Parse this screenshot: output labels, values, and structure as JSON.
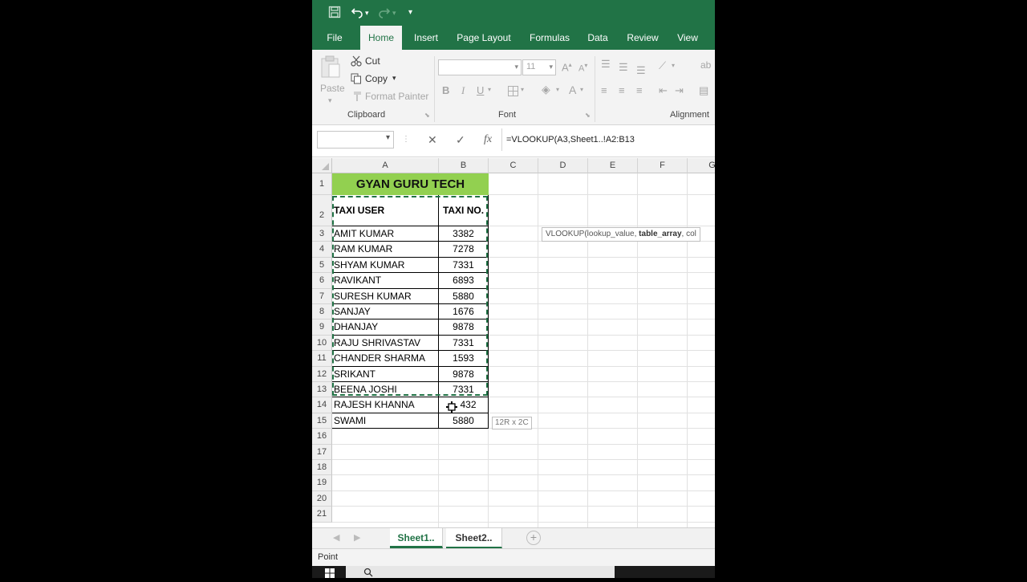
{
  "titlebar": {
    "save_icon": "save-icon",
    "undo_icon": "undo-icon",
    "redo_icon": "redo-icon",
    "customize_icon": "customize-quick-access-icon"
  },
  "ribbon_tabs": [
    "File",
    "Home",
    "Insert",
    "Page Layout",
    "Formulas",
    "Data",
    "Review",
    "View"
  ],
  "active_tab": "Home",
  "clipboard": {
    "paste_label": "Paste",
    "cut_label": "Cut",
    "copy_label": "Copy",
    "format_painter_label": "Format Painter",
    "group_label": "Clipboard"
  },
  "font_group": {
    "font_name": "",
    "font_size": "11",
    "bold": "B",
    "italic": "I",
    "underline": "U",
    "group_label": "Font"
  },
  "alignment_group": {
    "group_label": "Alignment"
  },
  "formula_bar": {
    "name_box": "",
    "cancel_symbol": "✕",
    "enter_symbol": "✓",
    "fx_symbol": "fx",
    "formula": "=VLOOKUP(A3,Sheet1..!A2:B13"
  },
  "columns": [
    "A",
    "B",
    "C",
    "D",
    "E",
    "F",
    "G"
  ],
  "rows": [
    "1",
    "2",
    "3",
    "4",
    "5",
    "6",
    "7",
    "8",
    "9",
    "10",
    "11",
    "12",
    "13",
    "14",
    "15",
    "16",
    "17",
    "18",
    "19",
    "20",
    "21"
  ],
  "sheet": {
    "title": "GYAN GURU TECH",
    "header_a": "TAXI USER",
    "header_b": "TAXI NO.",
    "data": [
      {
        "user": "AMIT KUMAR",
        "no": "3382"
      },
      {
        "user": "RAM KUMAR",
        "no": "7278"
      },
      {
        "user": "SHYAM KUMAR",
        "no": "7331"
      },
      {
        "user": "RAVIKANT",
        "no": "6893"
      },
      {
        "user": "SURESH KUMAR",
        "no": "5880"
      },
      {
        "user": "SANJAY",
        "no": "1676"
      },
      {
        "user": "DHANJAY",
        "no": "9878"
      },
      {
        "user": "RAJU SHRIVASTAV",
        "no": "7331"
      },
      {
        "user": "CHANDER SHARMA",
        "no": "1593"
      },
      {
        "user": "SRIKANT",
        "no": "9878"
      },
      {
        "user": "BEENA JOSHI",
        "no": "7331"
      },
      {
        "user": "RAJESH KHANNA",
        "no": "432"
      },
      {
        "user": "SWAMI",
        "no": "5880"
      }
    ]
  },
  "tooltip": {
    "prefix": "VLOOKUP(lookup_value, ",
    "bold": "table_array",
    "suffix": ", col"
  },
  "selection_size": "12R x 2C",
  "sheet_tabs": [
    "Sheet1..",
    "Sheet2.."
  ],
  "active_sheet": "Sheet1..",
  "status": "Point",
  "colors": {
    "excel_green": "#217346",
    "title_fill": "#92d050"
  }
}
